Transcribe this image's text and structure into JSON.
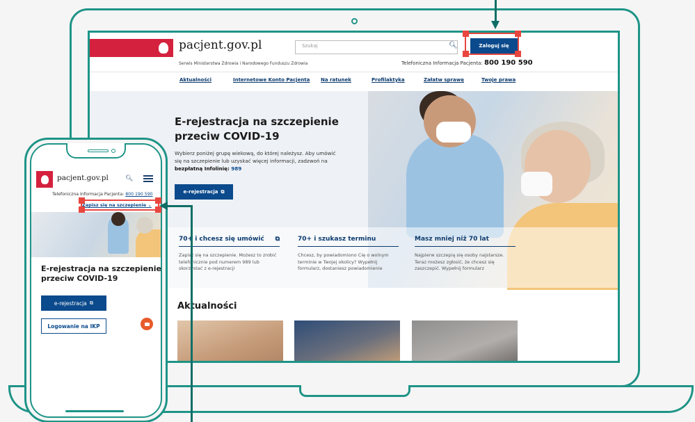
{
  "desktop": {
    "site_title": "pacjent.gov.pl",
    "site_subtitle": "Serwis Ministerstwa Zdrowia i Narodowego Funduszu Zdrowia",
    "search_placeholder": "Szukaj",
    "login_label": "Zaloguj się",
    "hotline_label": "Telefoniczna Informacja Pacjenta:",
    "hotline_number": "800 190 590",
    "nav": [
      "Aktualności",
      "Internetowe Konto Pacjenta",
      "Na ratunek",
      "Profilaktyka",
      "Załatw sprawę",
      "Twoje prawa"
    ],
    "hero": {
      "title": "E-rejestracja na szczepienie przeciw COVID-19",
      "text_1": "Wybierz poniżej grupę wiekową, do której należysz. Aby umówić się na szczepienie lub uzyskać więcej informacji, zadzwoń na ",
      "text_bold": "bezpłatną Infolinię:",
      "text_num": "989",
      "button_label": "e-rejestracja"
    },
    "cards": [
      {
        "title": "70+ i chcesz się umówić",
        "text": "Zapisz się na szczepienie. Możesz to zrobić telefonicznie pod numerem 989 lub skorzystać z e-rejestracji",
        "external": true
      },
      {
        "title": "70+ i szukasz terminu",
        "text": "Chcesz, by powiadomiono Cię o wolnym terminie w Twojej okolicy? Wypełnij formularz, dostaniesz powiadomienie",
        "external": false
      },
      {
        "title": "Masz mniej niż 70 lat",
        "text": "Najpierw szczepią się osoby najstarsze. Teraz możesz zgłosić, że chcesz się zaszczepić. Wypełnij formularz",
        "external": false
      }
    ],
    "news_heading": "Aktualności"
  },
  "mobile": {
    "site_title": "pacjent.gov.pl",
    "hotline_label": "Telefoniczna Informacja Pacjenta:",
    "hotline_number": "800 190 590",
    "dropdown_label": "Zapisz się na szczepienie",
    "hero_title": "E-rejestracja na szczepienie przeciw COVID-19",
    "button_primary": "e-rejestracja",
    "button_secondary": "Logowanie na IKP"
  },
  "colors": {
    "frame": "#1e9487",
    "arrow": "#0f6e66",
    "highlight": "#e8463f",
    "brand_red": "#d4213d",
    "primary_blue": "#0b4a8c"
  },
  "icons": [
    "eagle-emblem-icon",
    "search-icon",
    "external-link-icon",
    "hamburger-menu-icon",
    "chevron-down-icon",
    "chat-icon"
  ]
}
